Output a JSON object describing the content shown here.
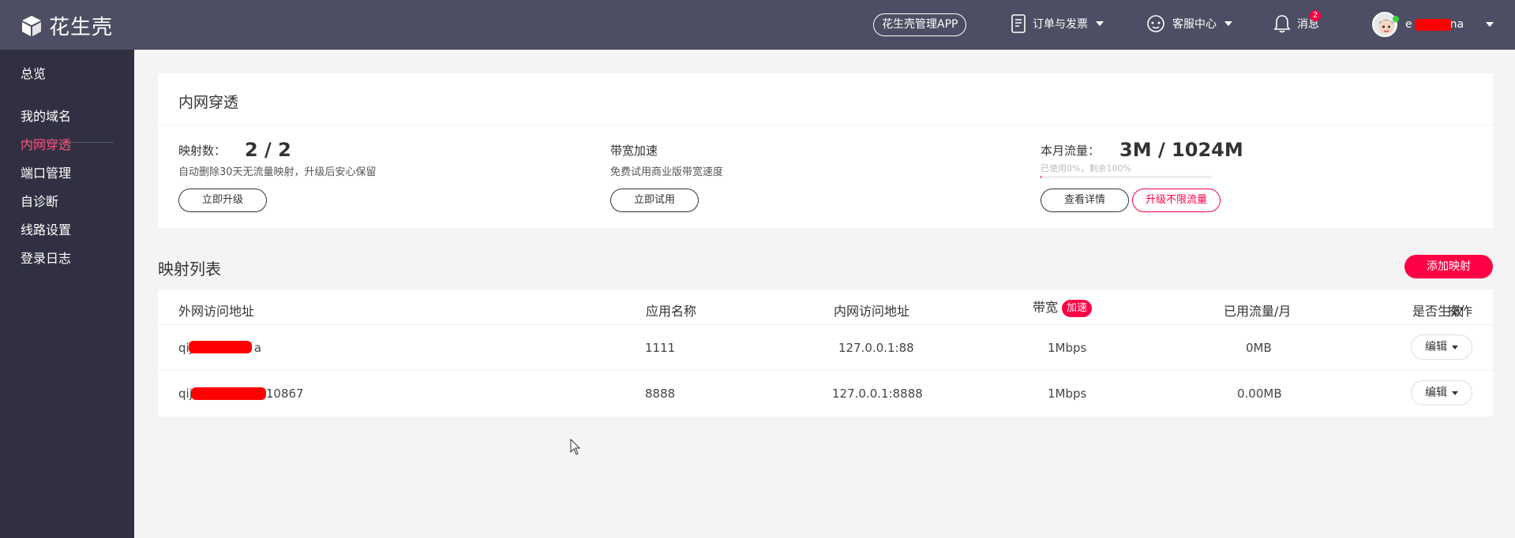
{
  "header": {
    "logo_text": "花生壳",
    "app_button": "花生壳管理APP",
    "orders_label": "订单与发票",
    "service_label": "客服中心",
    "messages_label": "消息",
    "messages_count": "2",
    "user_name_prefix": "e",
    "user_name_suffix": "na"
  },
  "sidebar": {
    "items": [
      {
        "label": "总览"
      },
      {
        "label": "我的域名"
      },
      {
        "label": "内网穿透",
        "active": true
      },
      {
        "label": "端口管理"
      },
      {
        "label": "自诊断"
      },
      {
        "label": "线路设置"
      },
      {
        "label": "登录日志"
      }
    ]
  },
  "overview": {
    "title": "内网穿透",
    "mappings_label": "映射数：",
    "mappings_value": "2 / 2",
    "mappings_desc": "自动删除30天无流量映射，升级后安心保留",
    "upgrade_button": "立即升级",
    "bandwidth_label": "带宽加速",
    "bandwidth_desc": "免费试用商业版带宽速度",
    "trial_button": "立即试用",
    "traffic_label": "本月流量：",
    "traffic_value": "3M / 1024M",
    "traffic_sub": "已使用0%，剩余100%",
    "traffic_used_fraction": 0.003,
    "details_button": "查看详情",
    "unlimited_button": "升级不限流量"
  },
  "mapping_list": {
    "title": "映射列表",
    "add_button": "添加映射",
    "columns": [
      "外网访问地址",
      "应用名称",
      "内网访问地址",
      "带宽",
      "已用流量/月",
      "是否生效",
      "操作"
    ],
    "speed_badge": "加速",
    "rows": [
      {
        "addr_prefix": "qij",
        "addr_suffix": "a",
        "app": "1111",
        "internal": "127.0.0.1:88",
        "bandwidth": "1Mbps",
        "traffic": "0MB",
        "enabled": true,
        "action": "编辑"
      },
      {
        "addr_prefix": "qij",
        "addr_suffix": "10867",
        "app": "8888",
        "internal": "127.0.0.1:8888",
        "bandwidth": "1Mbps",
        "traffic": "0.00MB",
        "enabled": true,
        "action": "编辑"
      }
    ]
  },
  "colors": {
    "topbar": "#4d4e63",
    "sidebar": "#303042",
    "accent": "#ff0044",
    "toggle_on": "#1aa01a"
  }
}
